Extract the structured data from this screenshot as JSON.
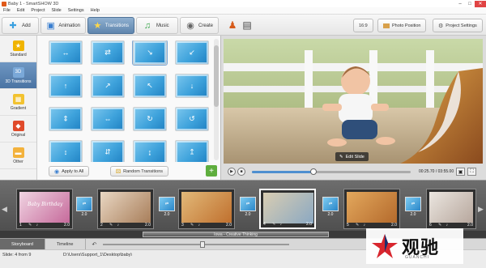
{
  "window": {
    "title": "Baby 1 - SmartSHOW 3D",
    "controls": [
      "–",
      "□",
      "✕"
    ]
  },
  "menu": [
    "File",
    "Edit",
    "Project",
    "Slide",
    "Settings",
    "Help"
  ],
  "toolbar": {
    "tabs": [
      {
        "label": "Add",
        "icon": "plus-icon"
      },
      {
        "label": "Animation",
        "icon": "film-icon"
      },
      {
        "label": "Transitions",
        "icon": "star-icon"
      },
      {
        "label": "Music",
        "icon": "music-note-icon"
      },
      {
        "label": "Create",
        "icon": "disc-icon"
      }
    ],
    "ratio": "16:9",
    "photo_position": "Photo Position",
    "project_settings": "Project Settings"
  },
  "categories": [
    {
      "label": "Standard",
      "color": "#f0b400",
      "icon": "★"
    },
    {
      "label": "3D Transitions",
      "color": "#7aa8d8",
      "icon": "3D"
    },
    {
      "label": "Gradient",
      "color": "#f2c230",
      "icon": "▦"
    },
    {
      "label": "Original",
      "color": "#e04a2a",
      "icon": "◆"
    },
    {
      "label": "Other",
      "color": "#f3b23c",
      "icon": "▬"
    }
  ],
  "transitions": {
    "tiles": [
      "↔",
      "⇄",
      "↘",
      "↙",
      "↑",
      "↗",
      "↖",
      "↓",
      "⇕",
      "⇔",
      "↻",
      "↺",
      "↕",
      "⇵",
      "↨",
      "↥"
    ],
    "apply_to_all": "Apply to All",
    "random": "Random Transitions"
  },
  "preview": {
    "edit_slide": "Edit Slide",
    "time": "00:25.70 / 03:55.00",
    "progress": 0.39
  },
  "timeline": {
    "slides": [
      {
        "num": "1",
        "dur": "2.0",
        "palette": [
          "#c66a9b",
          "#f0d4e2"
        ],
        "title": "Baby Birthday"
      },
      {
        "num": "2",
        "dur": "2.0",
        "palette": [
          "#a87e5a",
          "#e9d7c3"
        ],
        "title": ""
      },
      {
        "num": "3",
        "dur": "2.0",
        "palette": [
          "#c0702e",
          "#e2b979"
        ],
        "title": ""
      },
      {
        "num": "4",
        "dur": "2.0",
        "palette": [
          "#8aa8c2",
          "#d9cdb2"
        ],
        "title": ""
      },
      {
        "num": "5",
        "dur": "2.0",
        "palette": [
          "#b46a2c",
          "#e3a85d"
        ],
        "title": ""
      },
      {
        "num": "6",
        "dur": "2.0",
        "palette": [
          "#b7a79d",
          "#ebe6e0"
        ],
        "title": ""
      }
    ],
    "transitions": [
      "2.0",
      "2.0",
      "2.0",
      "2.0",
      "2.0",
      "2.0"
    ],
    "music": "Iowa - Creative Thinking"
  },
  "bottom_tabs": [
    "Storyboard",
    "Timeline"
  ],
  "status": {
    "slide": "Slide: 4 from 9",
    "path": "D:\\Users\\Support_1\\Desktop\\baby\\"
  },
  "watermark": {
    "cn": "观驰",
    "en": "GUANCHI"
  }
}
